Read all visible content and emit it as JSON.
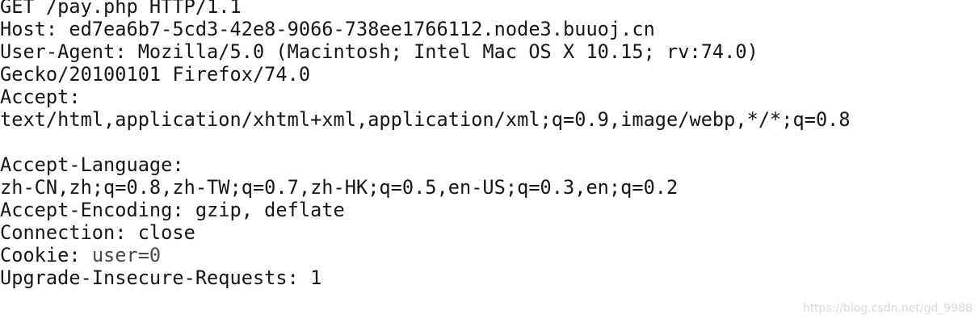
{
  "request": {
    "line_1": "GET /pay.php HTTP/1.1",
    "line_2": "Host: ed7ea6b7-5cd3-42e8-9066-738ee1766112.node3.buuoj.cn",
    "line_3": "User-Agent: Mozilla/5.0 (Macintosh; Intel Mac OS X 10.15; rv:74.0)",
    "line_4": "Gecko/20100101 Firefox/74.0",
    "line_5": "Accept:",
    "line_6": "text/html,application/xhtml+xml,application/xml;q=0.9,image/webp,*/*;q=0.8",
    "line_7": "",
    "line_8": "Accept-Language:",
    "line_9": "zh-CN,zh;q=0.8,zh-TW;q=0.7,zh-HK;q=0.5,en-US;q=0.3,en;q=0.2",
    "line_10": "Accept-Encoding: gzip, deflate",
    "line_11": "Connection: close",
    "cookie_key": "Cookie: ",
    "cookie_value": "user=0",
    "line_13": "Upgrade-Insecure-Requests: 1"
  },
  "watermark": "https://blog.csdn.net/gd_9988"
}
